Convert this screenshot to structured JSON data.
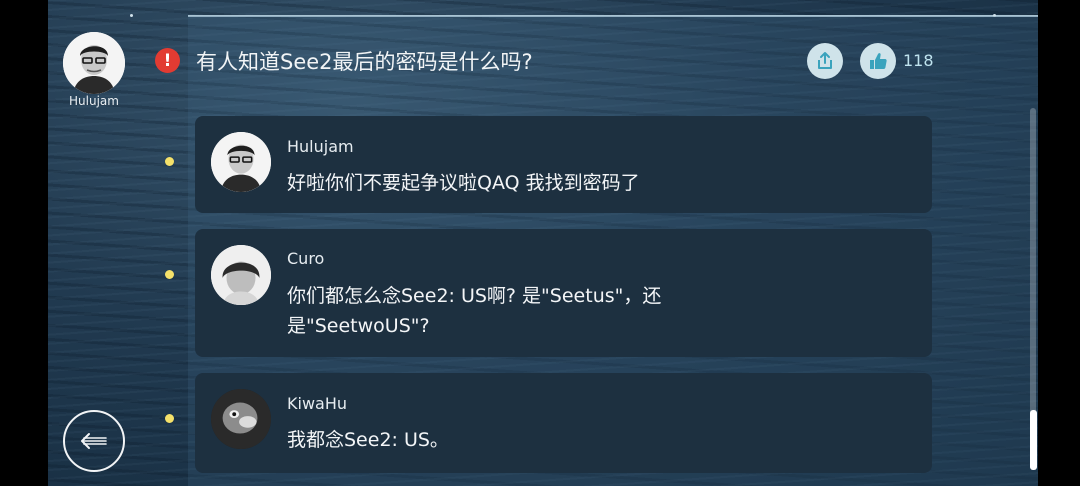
{
  "post": {
    "author": "Hulujam",
    "question": "有人知道See2最后的密码是什么吗?",
    "alert_icon": "!",
    "like_count": "118"
  },
  "icons": {
    "alert": "exclamation-icon",
    "share": "share-icon",
    "like": "thumbs-up-icon",
    "back": "back-arrow-icon"
  },
  "replies": [
    {
      "name": "Hulujam",
      "text": "好啦你们不要起争议啦QAQ 我找到密码了"
    },
    {
      "name": "Curo",
      "text": "你们都怎么念See2: US啊? 是\"Seetus\"，还是\"SeetwoUS\"?"
    },
    {
      "name": "KiwaHu",
      "text": "我都念See2: US。"
    }
  ],
  "colors": {
    "alert": "#e23b32",
    "bullet": "#f5e16a",
    "card": "#1d3040",
    "accent_button": "#cfe3ea",
    "like_button_icon": "#3aa3bd"
  }
}
